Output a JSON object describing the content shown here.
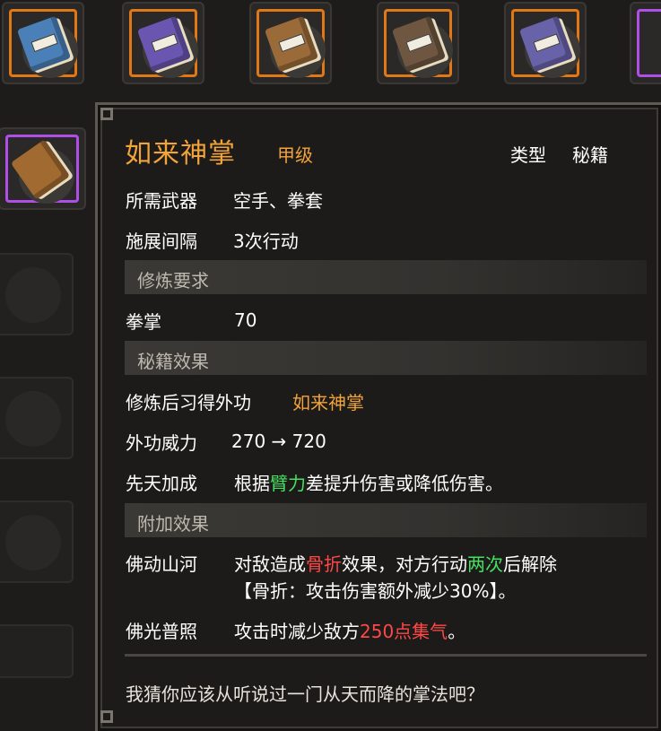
{
  "inventory": {
    "top_slots": [
      {
        "name": "blue-book",
        "color": "#4a7fb8",
        "frame": "orange"
      },
      {
        "name": "purple-book",
        "color": "#6a56b0",
        "frame": "orange"
      },
      {
        "name": "brown-book",
        "color": "#9a6a38",
        "frame": "orange"
      },
      {
        "name": "dark-brown-book",
        "color": "#6e5640",
        "frame": "orange"
      },
      {
        "name": "thick-purple-book",
        "color": "#6862a8",
        "frame": "orange"
      },
      {
        "name": "partial-book",
        "color": "#9a6a38",
        "frame": "purple"
      }
    ],
    "selected_slot": {
      "name": "open-brown-book",
      "color": "#a06a30",
      "frame": "purple"
    }
  },
  "item": {
    "name": "如来神掌",
    "grade": "甲级",
    "type_label": "类型",
    "type_value": "秘籍",
    "weapon_label": "所需武器",
    "weapon_value": "空手、拳套",
    "interval_label": "施展间隔",
    "interval_value": "3次行动"
  },
  "requirements": {
    "header": "修炼要求",
    "skill_label": "拳掌",
    "skill_value": "70"
  },
  "effects": {
    "header": "秘籍效果",
    "learn_label": "修炼后习得外功",
    "learn_value": "如来神掌",
    "power_label": "外功威力",
    "power_value": "270 → 720",
    "innate_label": "先天加成",
    "innate_pre": "根据",
    "innate_highlight": "臂力",
    "innate_post": "差提升伤害或降低伤害。"
  },
  "bonus": {
    "header": "附加效果",
    "e1_label": "佛动山河",
    "e1_pre": "对敌造成",
    "e1_red": "骨折",
    "e1_mid": "效果，对方行动",
    "e1_green": "两次",
    "e1_post": "后解除",
    "e1_line2": "【骨折：攻击伤害额外减少30%】。",
    "e2_label": "佛光普照",
    "e2_pre": "攻击时减少敌方",
    "e2_red": "250点集气",
    "e2_post": "。"
  },
  "flavor_text": "我猜你应该从听说过一门从天而降的掌法吧？",
  "colors": {
    "gold": "#f2a33a",
    "green": "#44e060",
    "red": "#ff4848",
    "white": "#ffffff"
  }
}
